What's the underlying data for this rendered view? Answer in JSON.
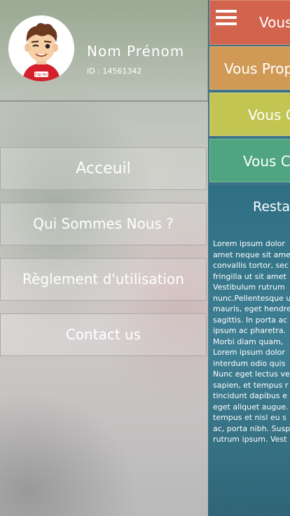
{
  "profile": {
    "name": "Nom Prénom",
    "id_label": "ID : 14561342",
    "avatar_badge": "Clip Art"
  },
  "menu": [
    {
      "label": "Acceuil"
    },
    {
      "label": "Qui Sommes Nous ?"
    },
    {
      "label": "Règlement d'utilisation"
    },
    {
      "label": "Contact us"
    }
  ],
  "tiles": [
    {
      "label": "Vous",
      "color": "#d2634c"
    },
    {
      "label": "Vous Prop",
      "color": "#d09955"
    },
    {
      "label": "Vous C",
      "color": "#c3c553"
    },
    {
      "label": "Vous C",
      "color": "#4ea57f"
    }
  ],
  "content": {
    "title": "Resta",
    "lorem_lines": [
      "Lorem ipsum dolor",
      "amet neque sit ame",
      "convallis tortor, sec",
      "fringilla ut sit amet",
      "Vestibulum rutrum",
      "nunc.Pellentesque u",
      "mauris, eget hendre",
      "sagittis. In porta ac",
      "ipsum ac pharetra.",
      "Morbi diam quam,",
      "Lorem ipsum dolor",
      "interdum odio quis",
      "Nunc eget lectus ve",
      "sapien, et tempus r",
      "tincidunt dapibus e",
      "eget aliquet augue.",
      "tempus et nisl eu s",
      "ac, porta nibh. Susp",
      "rutrum ipsum. Vest"
    ]
  },
  "icons": {
    "hamburger": "hamburger-menu-icon",
    "avatar": "cartoon-avatar"
  }
}
